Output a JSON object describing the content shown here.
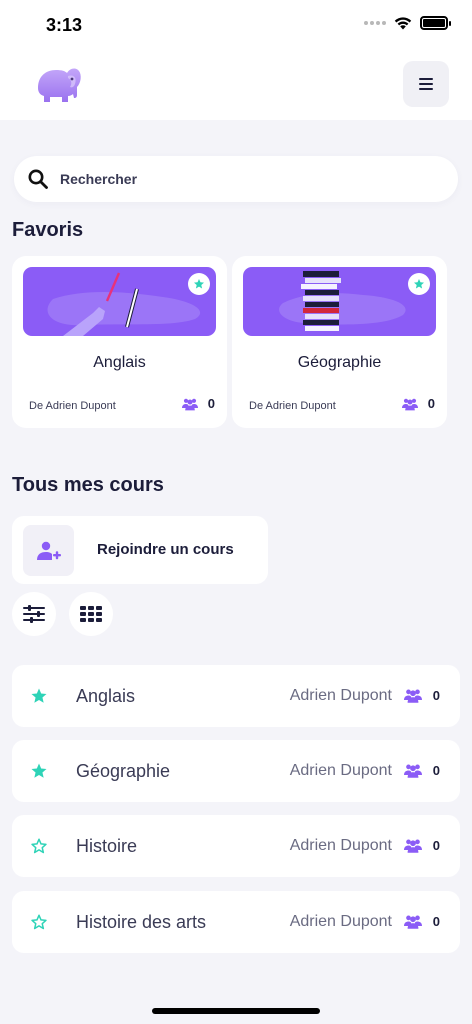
{
  "status_bar": {
    "time": "3:13"
  },
  "search": {
    "placeholder": "Rechercher",
    "value": ""
  },
  "favorites": {
    "title": "Favoris",
    "cards": [
      {
        "title": "Anglais",
        "author": "De Adrien Dupont",
        "count": "0"
      },
      {
        "title": "Géographie",
        "author": "De Adrien Dupont",
        "count": "0"
      }
    ]
  },
  "all_courses": {
    "title": "Tous mes cours",
    "join_label": "Rejoindre un cours"
  },
  "courses": [
    {
      "name": "Anglais",
      "teacher": "Adrien Dupont",
      "count": "0",
      "favorite": true
    },
    {
      "name": "Géographie",
      "teacher": "Adrien Dupont",
      "count": "0",
      "favorite": true
    },
    {
      "name": "Histoire",
      "teacher": "Adrien Dupont",
      "count": "0",
      "favorite": false
    },
    {
      "name": "Histoire des arts",
      "teacher": "Adrien Dupont",
      "count": "0",
      "favorite": false
    }
  ],
  "colors": {
    "accent": "#8b5cf6",
    "star": "#2ed3b7",
    "text": "#1c1d3a",
    "background": "#f4f4f9"
  },
  "icons": [
    "wifi-icon",
    "battery-icon",
    "elephant-logo",
    "menu-icon",
    "search-icon",
    "star-icon",
    "users-icon",
    "add-user-icon",
    "filter-icon",
    "grid-icon"
  ]
}
